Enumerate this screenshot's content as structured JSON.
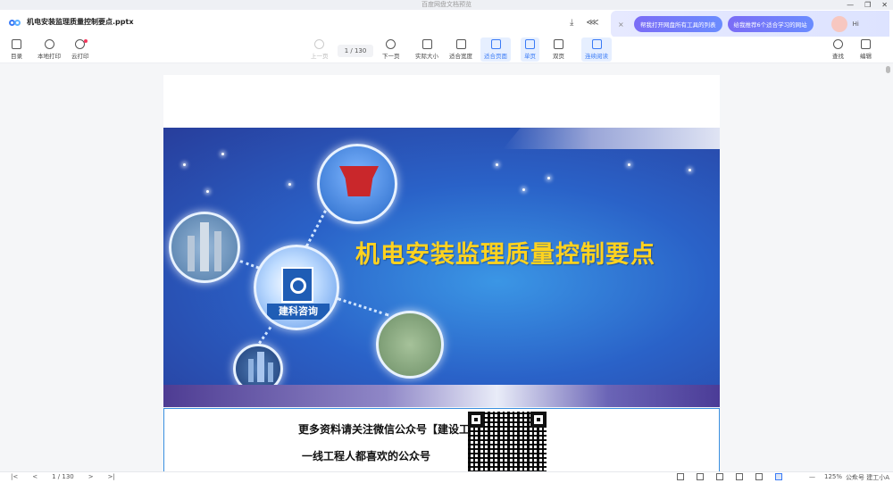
{
  "window": {
    "title": "百度网盘文档预览",
    "controls": [
      "—",
      "❐",
      "✕"
    ]
  },
  "header": {
    "file_name": "机电安装监理质量控制要点.pptx",
    "icons": [
      "download-icon",
      "share-icon"
    ]
  },
  "ai_assistant": {
    "close": "×",
    "suggestions": [
      "帮我打开网盘所有工具的列表",
      "给我推荐6个适合学习的网站"
    ],
    "greeting": "Hi"
  },
  "toolbar": {
    "toc": "目录",
    "local_print": "本地打印",
    "cloud_print": "云打印",
    "prev": "上一页",
    "page_indicator": "1 / 130",
    "next": "下一页",
    "actual_size": "实际大小",
    "fit_width": "适合宽度",
    "fit_page": "适合页面",
    "single": "单页",
    "double": "双页",
    "continuous": "连续阅读",
    "search": "查找",
    "edit": "编辑"
  },
  "slide1": {
    "title": "机电安装监理质量控制要点",
    "logo_text": "建科咨询"
  },
  "slide2": {
    "promo_line1": "更多资料请关注微信公众号【建设工程联盟】",
    "promo_line2": "一线工程人都喜欢的公众号"
  },
  "statusbar": {
    "first": "|<",
    "prev": "<",
    "page": "1 / 130",
    "next": ">",
    "last": ">|",
    "zoom_minus": "—",
    "zoom": "125%",
    "zoom_plus": "+",
    "watermark": "公众号 建工小A"
  },
  "colors": {
    "accent": "#3a7bf6",
    "slide_title": "#ffd21f",
    "slide_bg": "#2a62c8"
  }
}
